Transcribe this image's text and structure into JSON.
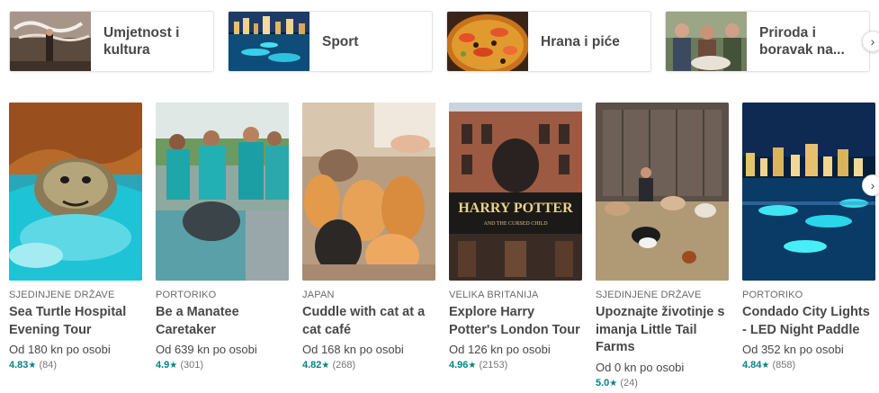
{
  "categories": [
    {
      "label": "Umjetnost i kultura"
    },
    {
      "label": "Sport"
    },
    {
      "label": "Hrana i piće"
    },
    {
      "label": "Priroda i boravak na..."
    }
  ],
  "experiences": [
    {
      "country": "SJEDINJENE DRŽAVE",
      "title": "Sea Turtle Hospital Evening Tour",
      "price": "Od 180 kn po osobi",
      "rating": "4.83",
      "reviews": "(84)"
    },
    {
      "country": "PORTORIKO",
      "title": "Be a Manatee Caretaker",
      "price": "Od 639 kn po osobi",
      "rating": "4.9",
      "reviews": "(301)"
    },
    {
      "country": "JAPAN",
      "title": "Cuddle with cat at a cat café",
      "price": "Od 168 kn po osobi",
      "rating": "4.82",
      "reviews": "(268)"
    },
    {
      "country": "VELIKA BRITANIJA",
      "title": "Explore Harry Potter's London Tour",
      "price": "Od 126 kn po osobi",
      "rating": "4.96",
      "reviews": "(2153)"
    },
    {
      "country": "SJEDINJENE DRŽAVE",
      "title": "Upoznajte životinje s imanja Little Tail Farms",
      "price": "Od 0 kn po osobi",
      "rating": "5.0",
      "reviews": "(24)"
    },
    {
      "country": "PORTORIKO",
      "title": "Condado City Lights - LED Night Paddle",
      "price": "Od 352 kn po osobi",
      "rating": "4.84",
      "reviews": "(858)"
    }
  ],
  "photo_text": {
    "harry_potter_sign": "HARRY POTTER",
    "cursed_child": "AND THE CURSED CHILD"
  },
  "icons": {
    "next": "›",
    "star": "★"
  },
  "colors": {
    "rating_accent": "#008489",
    "text": "#484848",
    "muted": "#767676"
  }
}
